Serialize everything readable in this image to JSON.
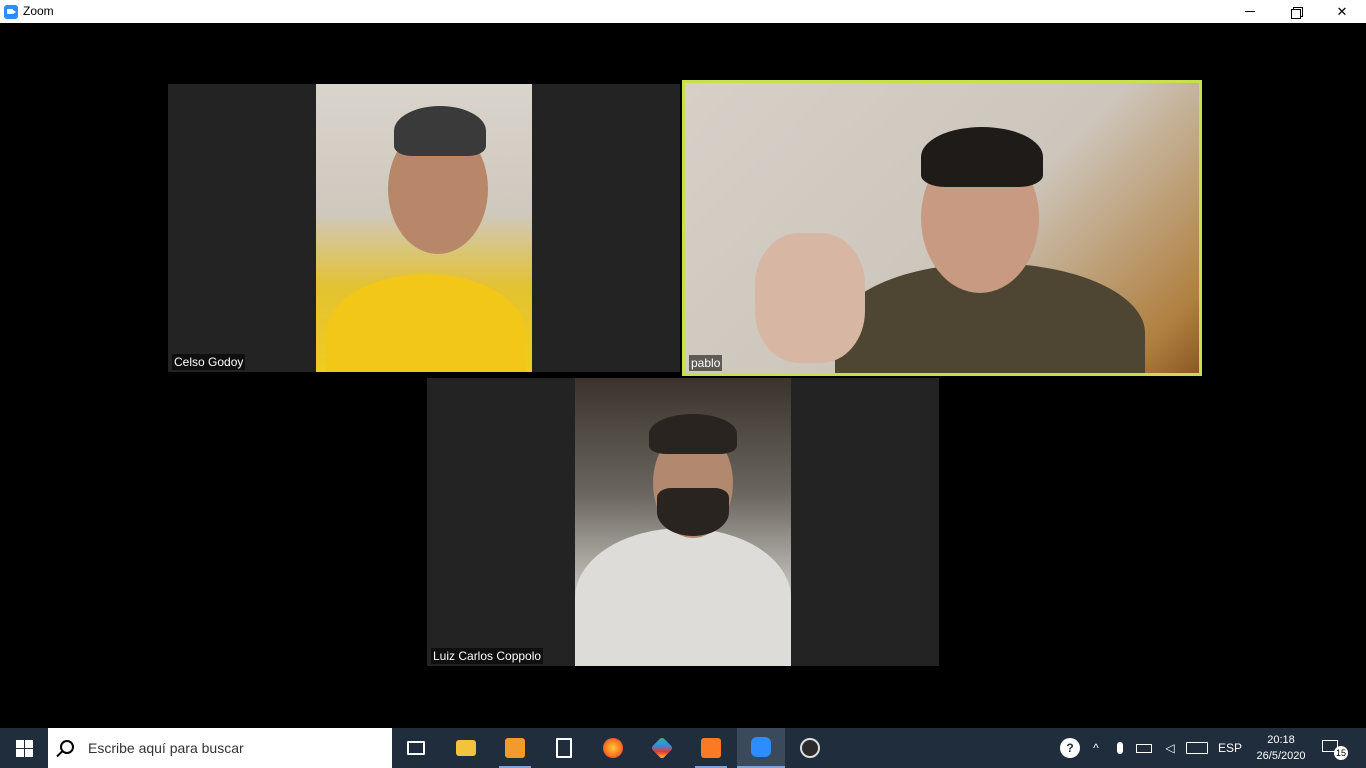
{
  "window": {
    "title": "Zoom"
  },
  "participants": [
    {
      "name": "Celso Godoy",
      "active_speaker": false
    },
    {
      "name": "pablo",
      "active_speaker": true
    },
    {
      "name": "Luiz Carlos Coppolo",
      "active_speaker": false
    }
  ],
  "taskbar": {
    "search_placeholder": "Escribe aquí para buscar",
    "apps": [
      {
        "name": "task-view-icon",
        "state": "normal"
      },
      {
        "name": "file-explorer-icon",
        "state": "normal"
      },
      {
        "name": "sublime-text-icon",
        "state": "running"
      },
      {
        "name": "calculator-icon",
        "state": "normal"
      },
      {
        "name": "firefox-icon",
        "state": "normal"
      },
      {
        "name": "git-icon",
        "state": "normal"
      },
      {
        "name": "xampp-icon",
        "state": "running"
      },
      {
        "name": "zoom-icon",
        "state": "active"
      },
      {
        "name": "obs-icon",
        "state": "normal"
      }
    ],
    "tray": {
      "language": "ESP",
      "time": "20:18",
      "date": "26/5/2020",
      "notification_count": "15"
    }
  },
  "colors": {
    "active_speaker_border": "#c8e04a",
    "taskbar_bg": "#1f2d3d",
    "zoom_blue": "#2d8cff"
  }
}
